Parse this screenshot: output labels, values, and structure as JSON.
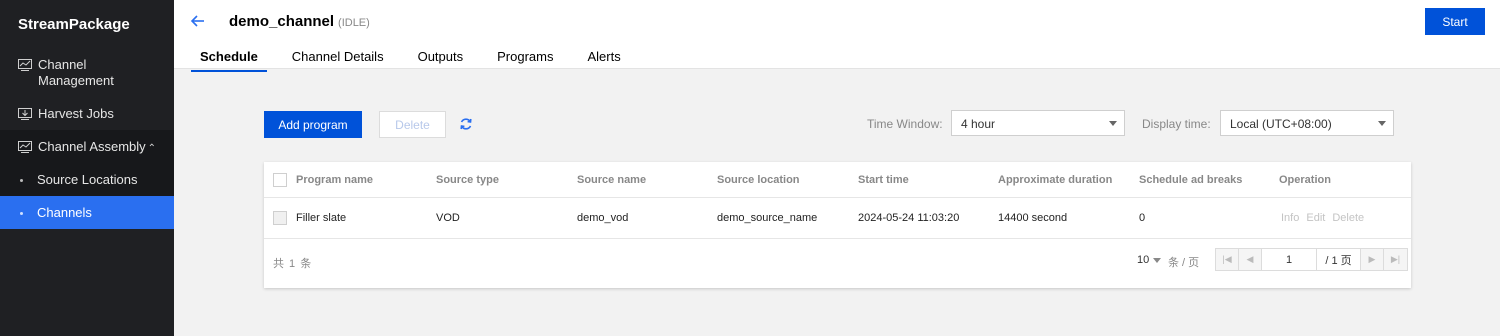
{
  "sidebar": {
    "brand": "StreamPackage",
    "items": [
      {
        "label": "Channel Management",
        "icon": "monitor-chart-icon"
      },
      {
        "label": "Harvest Jobs",
        "icon": "download-icon"
      },
      {
        "label": "Channel Assembly",
        "icon": "monitor-chart-icon"
      }
    ],
    "subitems": [
      {
        "label": "Source Locations"
      },
      {
        "label": "Channels"
      }
    ]
  },
  "header": {
    "title": "demo_channel",
    "status": "(IDLE)",
    "start_label": "Start",
    "tabs": [
      "Schedule",
      "Channel Details",
      "Outputs",
      "Programs",
      "Alerts"
    ]
  },
  "toolbar": {
    "add_label": "Add program",
    "delete_label": "Delete",
    "time_window_label": "Time Window:",
    "time_window_value": "4 hour",
    "display_time_label": "Display time:",
    "display_time_value": "Local (UTC+08:00)"
  },
  "table": {
    "columns": [
      "Program name",
      "Source type",
      "Source name",
      "Source location",
      "Start time",
      "Approximate duration",
      "Schedule ad breaks",
      "Operation"
    ],
    "rows": [
      {
        "program_name": "Filler slate",
        "source_type": "VOD",
        "source_name": "demo_vod",
        "source_location": "demo_source_name",
        "start_time": "2024-05-24 11:03:20",
        "duration": "14400 second",
        "ad_breaks": "0",
        "ops": [
          "Info",
          "Edit",
          "Delete"
        ]
      }
    ]
  },
  "pagination": {
    "total_text": "共 1 条",
    "page_size": "10",
    "per_page_text": "条 / 页",
    "current_page": "1",
    "total_pages_text": "/ 1 页"
  },
  "colors": {
    "accent": "#0052d9",
    "sidebar_bg": "#1f2023",
    "sidebar_active": "#2a6ff0"
  }
}
